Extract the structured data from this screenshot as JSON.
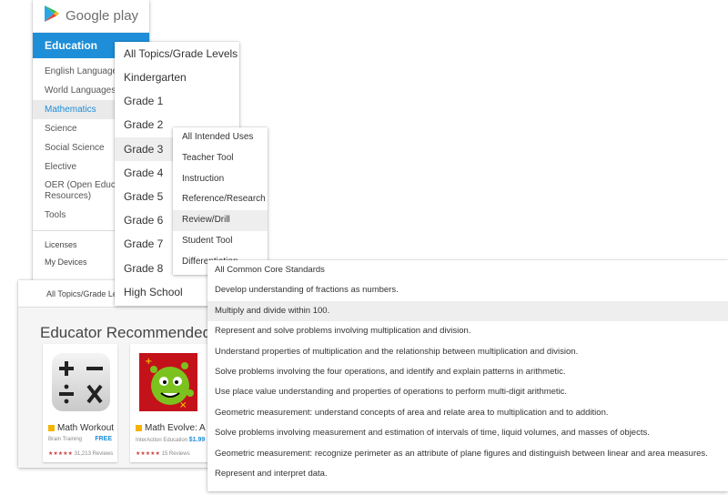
{
  "logo": {
    "text": "Google play"
  },
  "sidebar": {
    "header": "Education",
    "items": [
      {
        "label": "English Language Arts"
      },
      {
        "label": "World Languages"
      },
      {
        "label": "Mathematics"
      },
      {
        "label": "Science"
      },
      {
        "label": "Social Science"
      },
      {
        "label": "Elective"
      },
      {
        "label": "OER (Open Educational Resources)"
      },
      {
        "label": "Tools"
      }
    ],
    "bottom": [
      {
        "label": "Licenses"
      },
      {
        "label": "My Devices"
      }
    ]
  },
  "main": {
    "topic_filter": "All Topics/Grade Levels",
    "section_title": "Educator Recommended Apps",
    "cards": [
      {
        "name": "Math Workout",
        "developer": "Brain Training",
        "price": "FREE",
        "stars": "★★★★★",
        "reviews": "31,213 Reviews"
      },
      {
        "name": "Math Evolve: A Fun",
        "developer": "InterAction Education",
        "price": "$1.99",
        "stars": "★★★★★",
        "reviews": "15 Reviews"
      }
    ]
  },
  "grades": {
    "items": [
      {
        "label": "All Topics/Grade Levels"
      },
      {
        "label": "Kindergarten"
      },
      {
        "label": "Grade 1"
      },
      {
        "label": "Grade 2"
      },
      {
        "label": "Grade 3"
      },
      {
        "label": "Grade 4"
      },
      {
        "label": "Grade 5"
      },
      {
        "label": "Grade 6"
      },
      {
        "label": "Grade 7"
      },
      {
        "label": "Grade 8"
      },
      {
        "label": "High School"
      }
    ]
  },
  "uses": {
    "items": [
      {
        "label": "All Intended Uses"
      },
      {
        "label": "Teacher Tool"
      },
      {
        "label": "Instruction"
      },
      {
        "label": "Reference/Research"
      },
      {
        "label": "Review/Drill"
      },
      {
        "label": "Student Tool"
      },
      {
        "label": "Differentiation"
      }
    ]
  },
  "standards": {
    "items": [
      {
        "label": "All Common Core Standards"
      },
      {
        "label": "Develop understanding of fractions as numbers."
      },
      {
        "label": "Multiply and divide within 100."
      },
      {
        "label": "Represent and solve problems involving multiplication and division."
      },
      {
        "label": "Understand properties of multiplication and the relationship between multiplication and division."
      },
      {
        "label": "Solve problems involving the four operations, and identify and explain patterns in arithmetic."
      },
      {
        "label": "Use place value understanding and properties of operations to perform multi-digit arithmetic."
      },
      {
        "label": "Geometric measurement: understand concepts of area and relate area to multiplication and to addition."
      },
      {
        "label": "Solve problems involving measurement and estimation of intervals of time, liquid volumes, and masses of objects."
      },
      {
        "label": "Geometric measurement: recognize perimeter as an attribute of plane figures and distinguish between linear and area measures."
      },
      {
        "label": "Represent and interpret data."
      }
    ]
  },
  "colors": {
    "accent": "#1e8ed8",
    "highlight": "#eeeeee"
  }
}
